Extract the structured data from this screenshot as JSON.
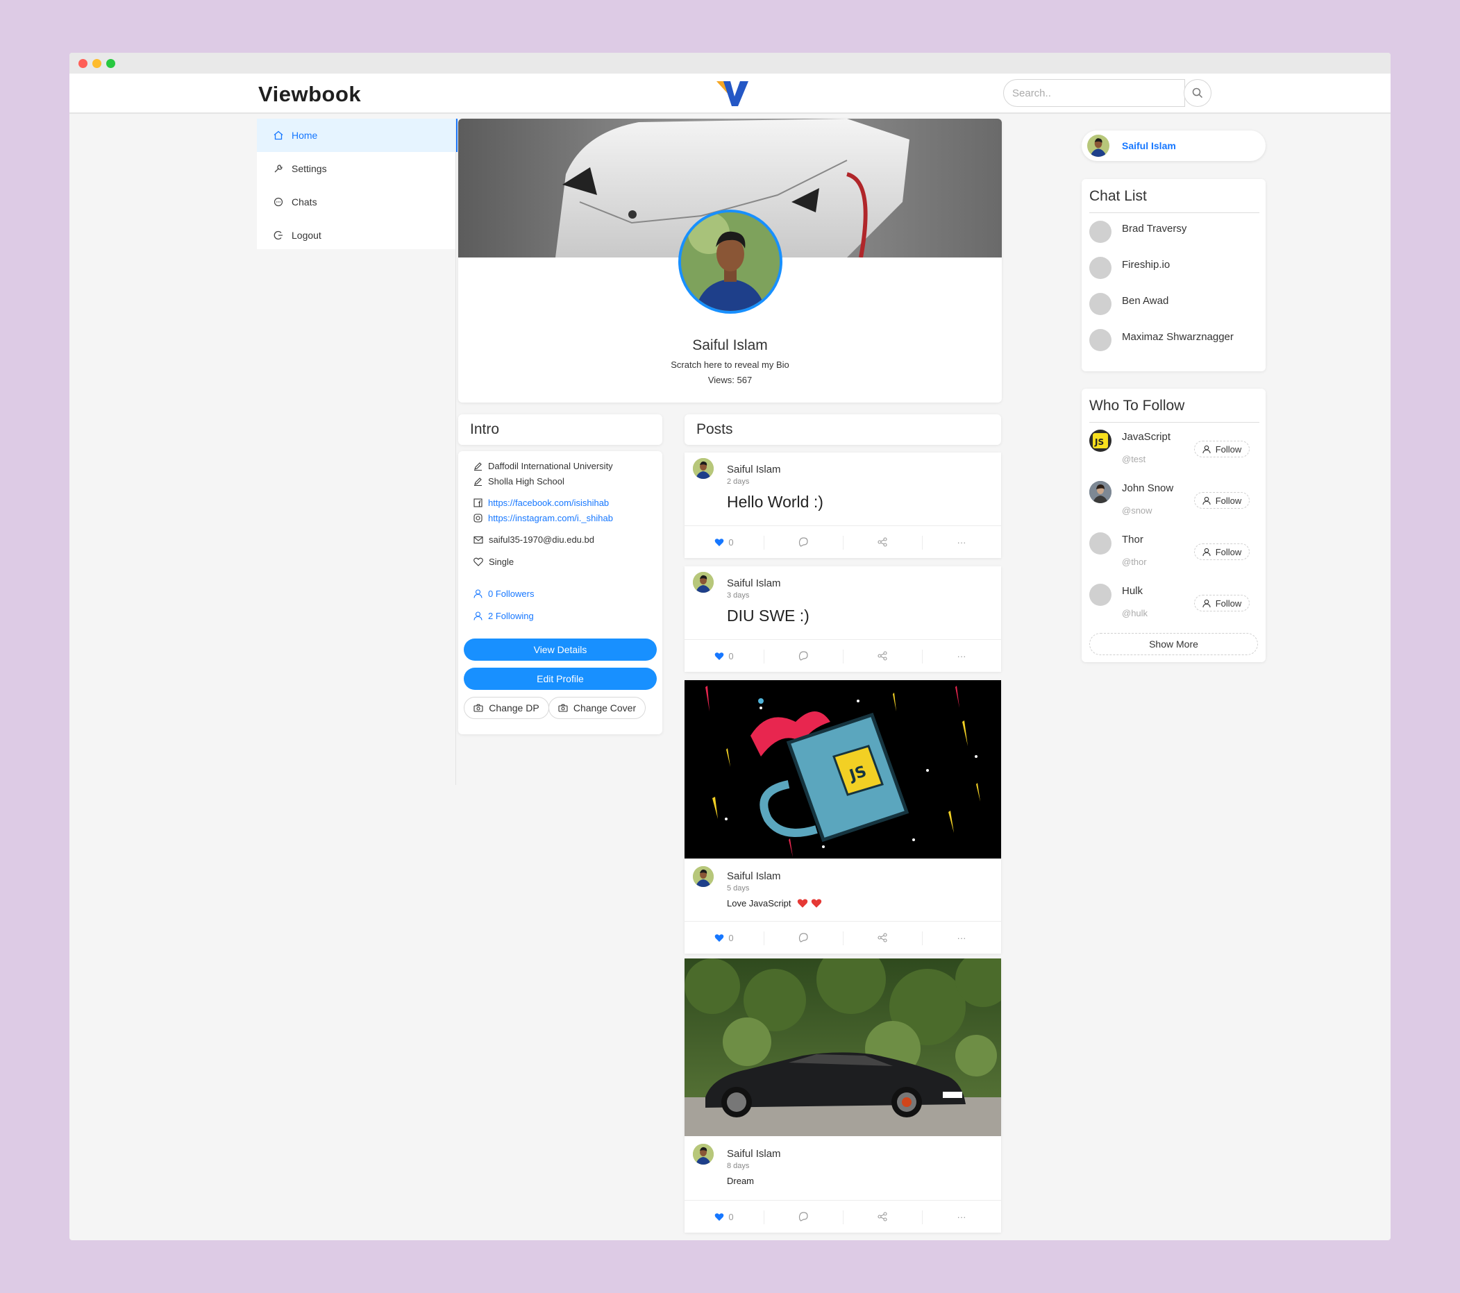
{
  "window": {
    "controls": [
      "close",
      "minimize",
      "maximize"
    ]
  },
  "header": {
    "brand": "Viewbook",
    "search_placeholder": "Search.."
  },
  "sidebar": {
    "items": [
      {
        "label": "Home",
        "icon": "home-icon",
        "active": true
      },
      {
        "label": "Settings",
        "icon": "wrench-icon",
        "active": false
      },
      {
        "label": "Chats",
        "icon": "chat-bubble-icon",
        "active": false
      },
      {
        "label": "Logout",
        "icon": "logout-icon",
        "active": false
      }
    ]
  },
  "profile": {
    "name": "Saiful Islam",
    "bio": "Scratch here to reveal my Bio",
    "views": "Views: 567"
  },
  "intro": {
    "title": "Intro",
    "education": [
      "Daffodil International University",
      "Sholla High School"
    ],
    "facebook": "https://facebook.com/isishihab",
    "instagram": "https://instagram.com/i._shihab",
    "email": "saiful35-1970@diu.edu.bd",
    "relationship": "Single",
    "followers": "0 Followers",
    "following": "2 Following",
    "view_details": "View Details",
    "edit_profile": "Edit Profile",
    "change_dp": "Change DP",
    "change_cover": "Change Cover"
  },
  "posts": {
    "title": "Posts",
    "items": [
      {
        "author": "Saiful Islam",
        "time": "2 days",
        "text": "Hello World :)",
        "likes": "0"
      },
      {
        "author": "Saiful Islam",
        "time": "3 days",
        "text": "DIU SWE :)",
        "likes": "0"
      },
      {
        "author": "Saiful Islam",
        "time": "5 days",
        "text": "Love JavaScript",
        "likes": "0"
      },
      {
        "author": "Saiful Islam",
        "time": "8 days",
        "text": "Dream",
        "likes": "0"
      }
    ],
    "more_label": "···"
  },
  "right": {
    "current_user": "Saiful Islam",
    "chat_list": {
      "title": "Chat List",
      "items": [
        "Brad Traversy",
        "Fireship.io",
        "Ben Awad",
        "Maximaz Shwarznagger"
      ]
    },
    "who_to_follow": {
      "title": "Who To Follow",
      "items": [
        {
          "name": "JavaScript",
          "handle": "@test",
          "button": "Follow"
        },
        {
          "name": "John Snow",
          "handle": "@snow",
          "button": "Follow"
        },
        {
          "name": "Thor",
          "handle": "@thor",
          "button": "Follow"
        },
        {
          "name": "Hulk",
          "handle": "@hulk",
          "button": "Follow"
        }
      ],
      "show_more": "Show More"
    }
  },
  "colors": {
    "accent": "#1890ff",
    "background": "#ddcbe5",
    "like": "#1677ff",
    "heart": "#e53935"
  }
}
